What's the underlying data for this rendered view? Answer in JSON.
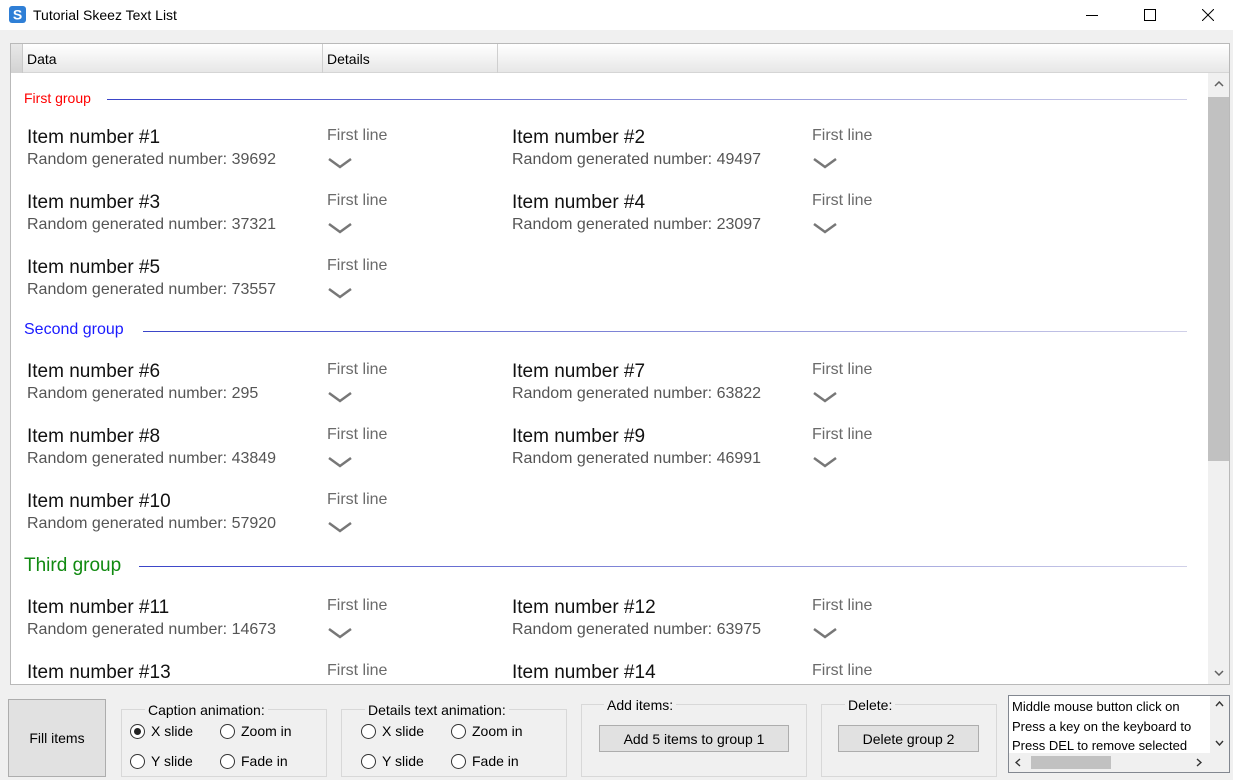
{
  "window": {
    "title": "Tutorial Skeez Text List"
  },
  "columns": [
    {
      "label": "Data"
    },
    {
      "label": "Details"
    }
  ],
  "groups": [
    {
      "label": "First group",
      "color": "#ff0000"
    },
    {
      "label": "Second group",
      "color": "#1a1aff"
    },
    {
      "label": "Third group",
      "color": "#108a10"
    }
  ],
  "items": [
    {
      "title": "Item number #1",
      "sub": "Random generated number: 39692",
      "detail": "First line"
    },
    {
      "title": "Item number #2",
      "sub": "Random generated number: 49497",
      "detail": "First line"
    },
    {
      "title": "Item number #3",
      "sub": "Random generated number: 37321",
      "detail": "First line"
    },
    {
      "title": "Item number #4",
      "sub": "Random generated number: 23097",
      "detail": "First line"
    },
    {
      "title": "Item number #5",
      "sub": "Random generated number: 73557",
      "detail": "First line"
    },
    {
      "title": "Item number #6",
      "sub": "Random generated number: 295",
      "detail": "First line"
    },
    {
      "title": "Item number #7",
      "sub": "Random generated number: 63822",
      "detail": "First line"
    },
    {
      "title": "Item number #8",
      "sub": "Random generated number: 43849",
      "detail": "First line"
    },
    {
      "title": "Item number #9",
      "sub": "Random generated number: 46991",
      "detail": "First line"
    },
    {
      "title": "Item number #10",
      "sub": "Random generated number: 57920",
      "detail": "First line"
    },
    {
      "title": "Item number #11",
      "sub": "Random generated number: 14673",
      "detail": "First line"
    },
    {
      "title": "Item number #12",
      "sub": "Random generated number: 63975",
      "detail": "First line"
    },
    {
      "title": "Item number #13",
      "sub": "",
      "detail": "First line"
    },
    {
      "title": "Item number #14",
      "sub": "",
      "detail": "First line"
    }
  ],
  "controls": {
    "fill_items": "Fill items",
    "caption_animation": {
      "title": "Caption animation:",
      "x_slide": "X slide",
      "zoom_in": "Zoom in",
      "y_slide": "Y slide",
      "fade_in": "Fade in",
      "selected": "X slide"
    },
    "details_animation": {
      "title": "Details text animation:",
      "x_slide": "X slide",
      "zoom_in": "Zoom in",
      "y_slide": "Y slide",
      "fade_in": "Fade in"
    },
    "add_items": {
      "title": "Add items:",
      "button": "Add 5 items to group 1"
    },
    "delete": {
      "title": "Delete:",
      "button": "Delete group 2"
    },
    "info_lines": [
      "Middle mouse button click on",
      "Press a key on the keyboard to",
      "Press DEL to remove selected"
    ]
  },
  "icons": {
    "app": "skeez-s-icon",
    "minimize": "minimize-icon",
    "maximize": "maximize-icon",
    "close": "close-icon",
    "expand": "chevron-down-icon"
  },
  "colors": {
    "separator_line": "#5058c8",
    "scroll_thumb": "#c1c1c1"
  }
}
